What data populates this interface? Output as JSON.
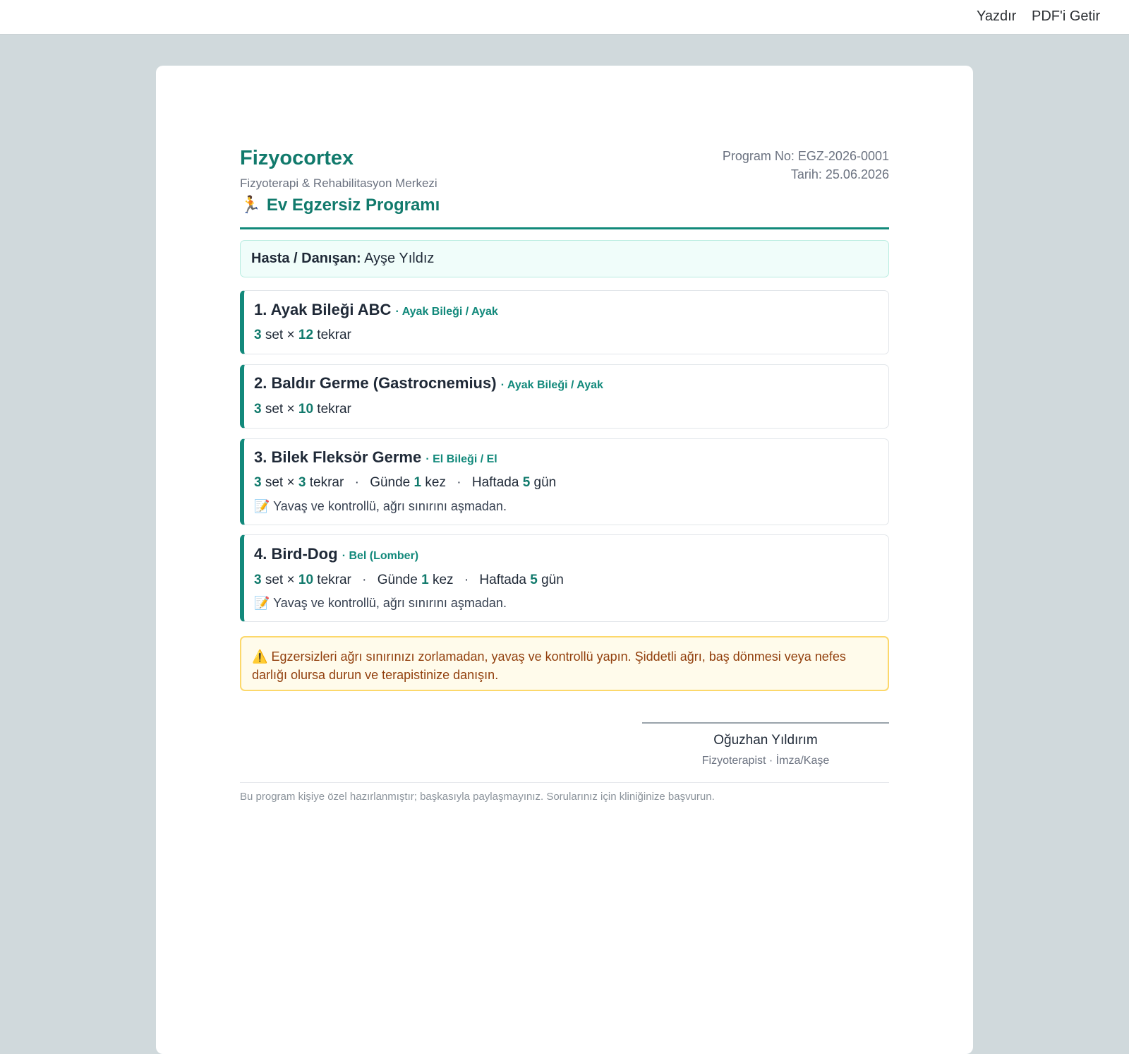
{
  "toolbar": {
    "print_label": "Yazdır",
    "pdf_label": "PDF'i Getir"
  },
  "header": {
    "brand": "Fizyocortex",
    "subtitle": "Fizyoterapi & Rehabilitasyon Merkezi",
    "program_icon": "🏃",
    "program_title": "Ev Egzersiz Programı",
    "program_no": "Program No: EGZ-2026-0001",
    "date": "Tarih: 25.06.2026"
  },
  "patient": {
    "label": "Hasta / Danışan:",
    "name": "Ayşe Yıldız"
  },
  "exercises": [
    {
      "title": "1. Ayak Bileği ABC",
      "category": "· Ayak Bileği / Ayak",
      "sets": "3",
      "set_word": "set ×",
      "reps": "12",
      "reps_word": "tekrar"
    },
    {
      "title": "2. Baldır Germe (Gastrocnemius)",
      "category": "· Ayak Bileği / Ayak",
      "sets": "3",
      "set_word": "set ×",
      "reps": "10",
      "reps_word": "tekrar"
    },
    {
      "title": "3. Bilek Fleksör Germe",
      "category": "· El Bileği / El",
      "sets": "3",
      "set_word": "set ×",
      "reps": "3",
      "reps_word": "tekrar",
      "sep": "·",
      "daily_prefix": "Günde",
      "daily": "1",
      "daily_suffix": "kez",
      "weekly_prefix": "Haftada",
      "weekly": "5",
      "weekly_suffix": "gün",
      "note_icon": "📝",
      "note": "Yavaş ve kontrollü, ağrı sınırını aşmadan."
    },
    {
      "title": "4. Bird-Dog",
      "category": "· Bel (Lomber)",
      "sets": "3",
      "set_word": "set ×",
      "reps": "10",
      "reps_word": "tekrar",
      "sep": "·",
      "daily_prefix": "Günde",
      "daily": "1",
      "daily_suffix": "kez",
      "weekly_prefix": "Haftada",
      "weekly": "5",
      "weekly_suffix": "gün",
      "note_icon": "📝",
      "note": "Yavaş ve kontrollü, ağrı sınırını aşmadan."
    }
  ],
  "warning": {
    "icon": "⚠️",
    "text": "Egzersizleri ağrı sınırınızı zorlamadan, yavaş ve kontrollü yapın. Şiddetli ağrı, baş dönmesi veya nefes darlığı olursa durun ve terapistinize danışın."
  },
  "signature": {
    "name": "Oğuzhan Yıldırım",
    "role": "Fizyoterapist · İmza/Kaşe"
  },
  "footer": {
    "text": "Bu program kişiye özel hazırlanmıştır; başkasıyla paylaşmayınız. Sorularınız için kliniğinize başvurun."
  },
  "colors": {
    "accent": "#117a6c",
    "background": "#d0d9dc",
    "warning_bg": "#fffbeb",
    "warning_text": "#92400e"
  }
}
